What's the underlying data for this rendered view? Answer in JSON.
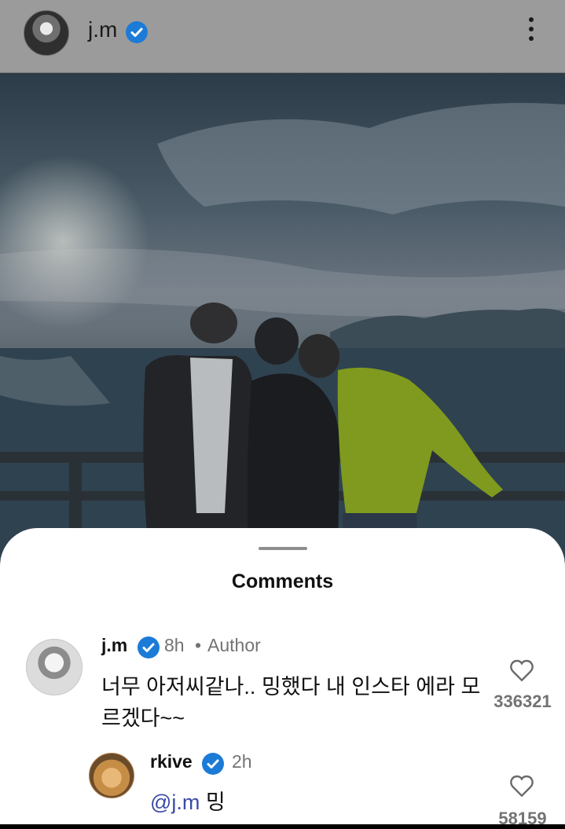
{
  "header": {
    "username": "j.m"
  },
  "sheet": {
    "title": "Comments"
  },
  "comments": [
    {
      "username": "j.m",
      "time": "8h",
      "separator": "•",
      "badge": "Author",
      "text": "너무 아저씨같나.. 밍했다 내 인스타 에라 모르겠다~~",
      "likes": "336321"
    },
    {
      "username": "rkive",
      "time": "2h",
      "mention": "@j.m",
      "text": " 밍",
      "likes": "58159"
    }
  ],
  "colors": {
    "verified": "#1d7bd8",
    "mention": "#3b4aa8",
    "muted": "#737373"
  }
}
